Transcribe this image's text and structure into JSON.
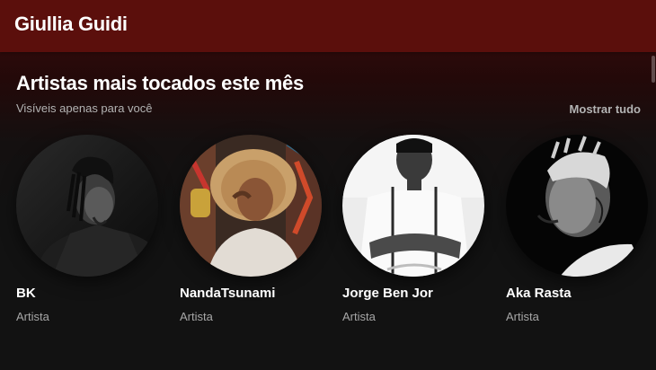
{
  "header": {
    "title": "Giullia Guidi"
  },
  "section": {
    "title": "Artistas mais tocados este mês",
    "subtitle": "Visíveis apenas para você",
    "show_all": "Mostrar tudo"
  },
  "artists": [
    {
      "name": "BK",
      "type": "Artista"
    },
    {
      "name": "NandaTsunami",
      "type": "Artista"
    },
    {
      "name": "Jorge Ben Jor",
      "type": "Artista"
    },
    {
      "name": "Aka Rasta",
      "type": "Artista"
    }
  ],
  "colors": {
    "header_bg": "#5b0f0c",
    "page_bg": "#121212",
    "text_secondary": "#b3b3b3"
  }
}
